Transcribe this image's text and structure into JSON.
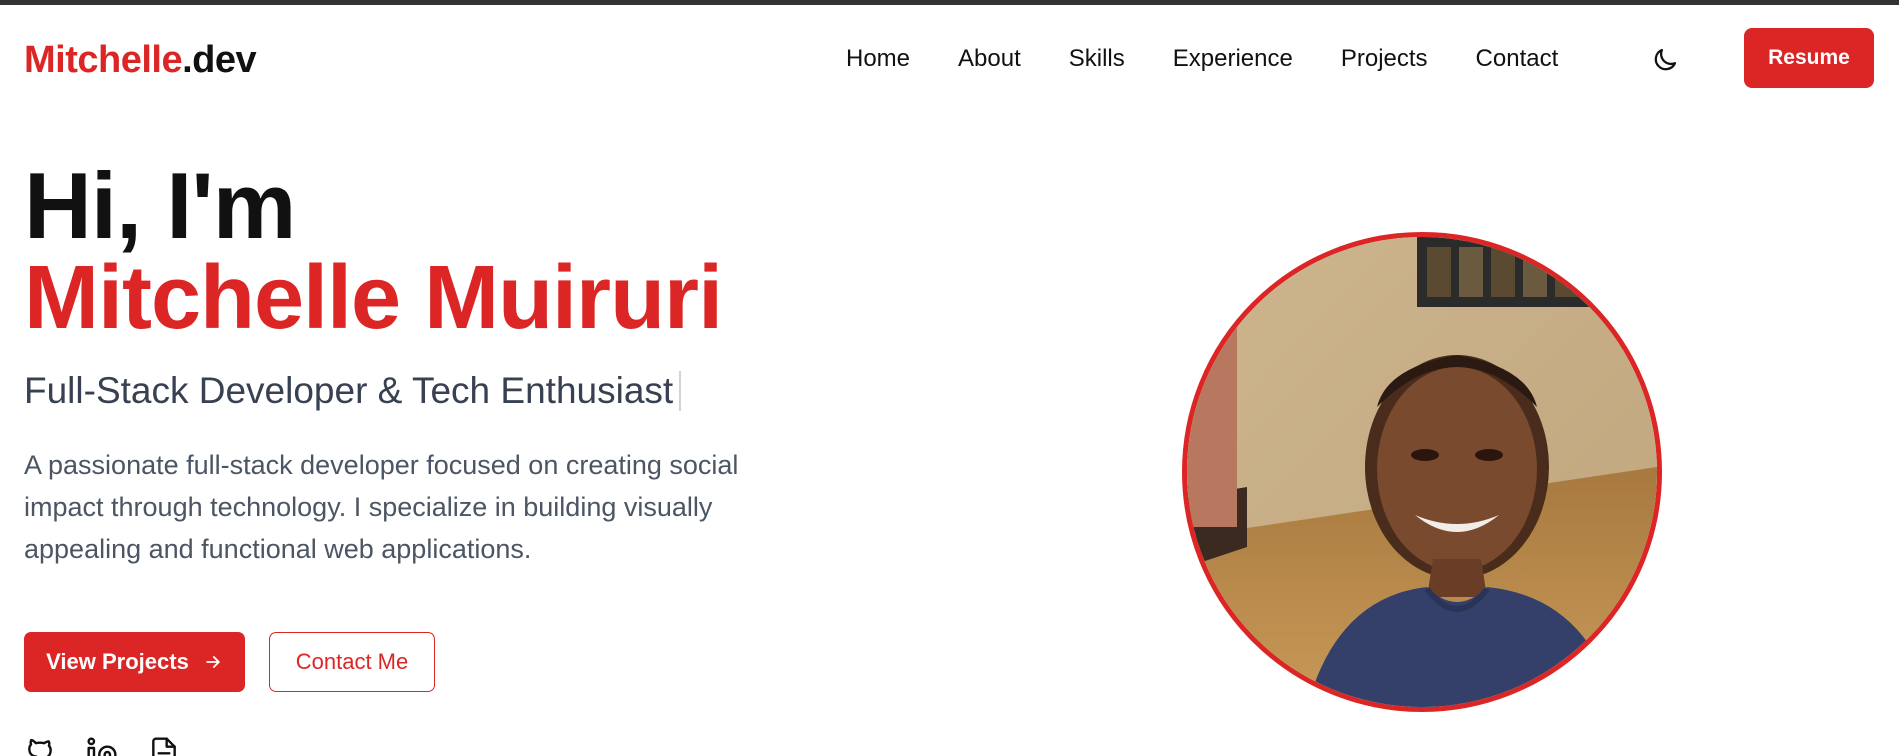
{
  "brand": {
    "name_part1": "Mitchelle",
    "name_part2": ".dev"
  },
  "nav": {
    "links": [
      "Home",
      "About",
      "Skills",
      "Experience",
      "Projects",
      "Contact"
    ],
    "theme_icon": "moon-icon",
    "resume_label": "Resume"
  },
  "hero": {
    "greeting": "Hi, I'm",
    "name": "Mitchelle Muiruri",
    "tagline": "Full-Stack Developer & Tech Enthusiast",
    "description": "A passionate full-stack developer focused on creating social impact through technology. I specialize in building visually appealing and functional web applications.",
    "primary_cta": "View Projects",
    "secondary_cta": "Contact Me"
  },
  "socials": [
    "github-icon",
    "linkedin-icon",
    "resume-file-icon"
  ],
  "colors": {
    "accent": "#dc2626",
    "text": "#111111",
    "muted": "#4b5563"
  }
}
